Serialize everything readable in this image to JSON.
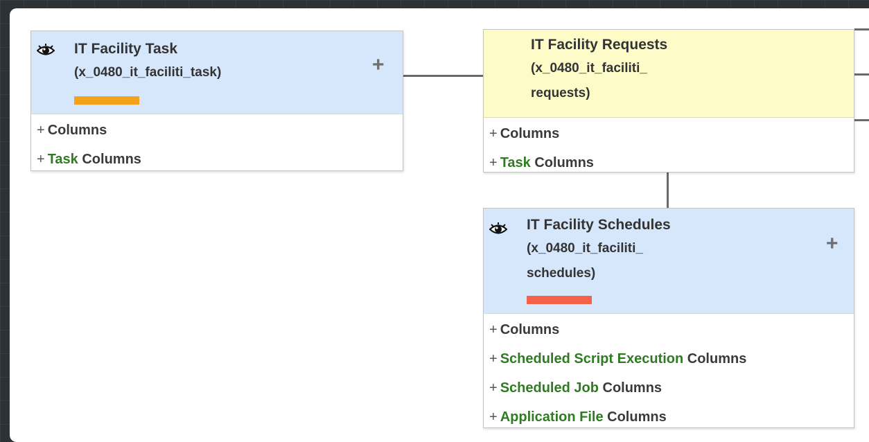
{
  "cards": {
    "task": {
      "title": "IT Facility Task",
      "subtitle_lines": [
        "(x_0480_it_faciliti_task)"
      ],
      "has_eye": true,
      "has_plus": true,
      "bar_color": "#f5a21b",
      "header_color": "#d6e6fb",
      "sections": [
        {
          "plus": "+",
          "highlight": "",
          "label": "Columns"
        },
        {
          "plus": "+",
          "highlight": "Task",
          "label": " Columns"
        }
      ]
    },
    "requests": {
      "title": "IT Facility Requests",
      "subtitle_lines": [
        "(x_0480_it_faciliti_",
        "requests)"
      ],
      "has_eye": false,
      "has_plus": false,
      "header_color": "#fdfbc8",
      "sections": [
        {
          "plus": "+",
          "highlight": "",
          "label": "Columns"
        },
        {
          "plus": "+",
          "highlight": "Task",
          "label": " Columns"
        }
      ]
    },
    "schedules": {
      "title": "IT Facility Schedules",
      "subtitle_lines": [
        "(x_0480_it_faciliti_",
        "schedules)"
      ],
      "has_eye": true,
      "has_plus": true,
      "bar_color": "#f4624c",
      "header_color": "#d6e6fb",
      "sections": [
        {
          "plus": "+",
          "highlight": "",
          "label": "Columns"
        },
        {
          "plus": "+",
          "highlight": "Scheduled Script Execution",
          "label": " Columns"
        },
        {
          "plus": "+",
          "highlight": "Scheduled Job",
          "label": " Columns"
        },
        {
          "plus": "+",
          "highlight": "Application File",
          "label": " Columns"
        }
      ]
    }
  },
  "icons": {
    "eye": "eye-icon",
    "plus": "plus-icon"
  },
  "colors": {
    "accent_green": "#2f7b22",
    "connector": "#6a6a6a"
  }
}
